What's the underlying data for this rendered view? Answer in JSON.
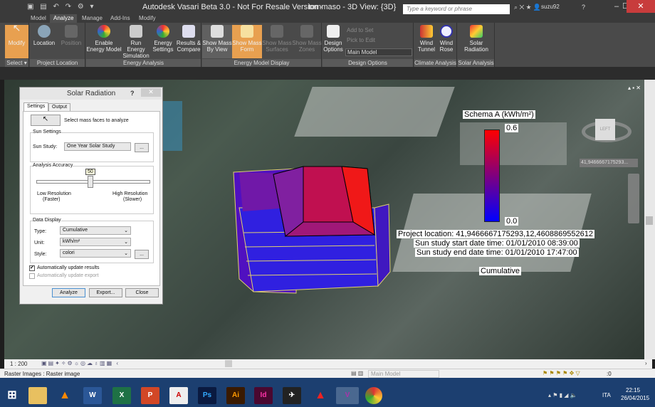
{
  "app": {
    "title": "Autodesk Vasari Beta 3.0 - Not For Resale Version -",
    "doc_title": "tommaso - 3D View: {3D}",
    "search_placeholder": "Type a keyword or phrase",
    "user": "suzu92",
    "help": "?"
  },
  "tabs": [
    {
      "label": "Model"
    },
    {
      "label": "Analyze",
      "active": true
    },
    {
      "label": "Manage"
    },
    {
      "label": "Add-Ins"
    },
    {
      "label": "Modify"
    }
  ],
  "ribbon": {
    "panels": [
      {
        "label": "Select ▾",
        "buttons": [
          {
            "label": "Modify",
            "active": true
          }
        ]
      },
      {
        "label": "Project Location",
        "buttons": [
          {
            "label": "Location"
          },
          {
            "label": "Position",
            "disabled": true
          }
        ]
      },
      {
        "label": "Energy Analysis",
        "buttons": [
          {
            "label": "Enable Energy Model"
          },
          {
            "label": "Run Energy Simulation"
          },
          {
            "label": "Energy Settings"
          },
          {
            "label": "Results & Compare"
          }
        ]
      },
      {
        "label": "Energy Model Display",
        "buttons": [
          {
            "label": "Show Mass By View"
          },
          {
            "label": "Show Mass Form",
            "active": true
          },
          {
            "label": "Show Mass Surfaces",
            "disabled": true
          },
          {
            "label": "Show Mass Zones",
            "disabled": true
          }
        ]
      },
      {
        "label": "Design Options",
        "buttons": [
          {
            "label": "Design Options"
          }
        ],
        "small": [
          {
            "label": "Add to Set"
          },
          {
            "label": "Pick to Edit"
          }
        ],
        "select": "Main Model"
      },
      {
        "label": "Climate Analysis",
        "buttons": [
          {
            "label": "Wind Tunnel"
          },
          {
            "label": "Wind Rose"
          }
        ]
      },
      {
        "label": "Solar Analysis",
        "buttons": [
          {
            "label": "Solar Radiation"
          }
        ]
      }
    ]
  },
  "dialog": {
    "title": "Solar Radiation",
    "help": "?",
    "close": "✕",
    "tabs": [
      "Settings",
      "Output"
    ],
    "select_faces": "Select mass faces to analyze",
    "sun_settings": "Sun Settings",
    "sun_study_label": "Sun Study:",
    "sun_study_value": "One Year Solar Study",
    "ellipsis": "...",
    "accuracy_label": "Analysis Accuracy",
    "accuracy_value": "50",
    "accuracy_fraction": 0.5,
    "low": "Low Resolution",
    "low_sub": "(Faster)",
    "high": "High Resolution",
    "high_sub": "(Slower)",
    "data_display": "Data Display",
    "type_label": "Type:",
    "type_value": "Cumulative",
    "unit_label": "Unit:",
    "unit_value": "kWh/m²",
    "style_label": "Style:",
    "style_value": "colori",
    "auto_update_results": "Automatically update results",
    "auto_update_results_checked": true,
    "auto_update_export": "Automatically update export",
    "auto_update_export_checked": false,
    "analyze": "Analyze",
    "export": "Export...",
    "close_btn": "Close"
  },
  "legend": {
    "title": "Schema A (kWh/m²)",
    "max": "0.6",
    "min": "0.0",
    "color_max": "#ff0000",
    "color_min": "#0000ff"
  },
  "info": {
    "location": "Project location: 41,9466667175293,12,4608869552612",
    "start": "Sun study start date time: 01/01/2010 08:39:00",
    "end": "Sun study end date time: 01/01/2010 17:47:00",
    "mode": "Cumulative"
  },
  "viewcube": {
    "face": "LEFT",
    "coords": "41,9466667175293..."
  },
  "viewctl": {
    "scale": "1 : 200"
  },
  "status": {
    "text": "Raster Images : Raster image",
    "model": "Main Model",
    "filter": ":0"
  },
  "taskbar": {
    "apps": [
      "W",
      "X",
      "P",
      "Ps",
      "Ai",
      "Id"
    ],
    "lang": "ITA",
    "time": "22:15",
    "date": "26/04/2015"
  }
}
